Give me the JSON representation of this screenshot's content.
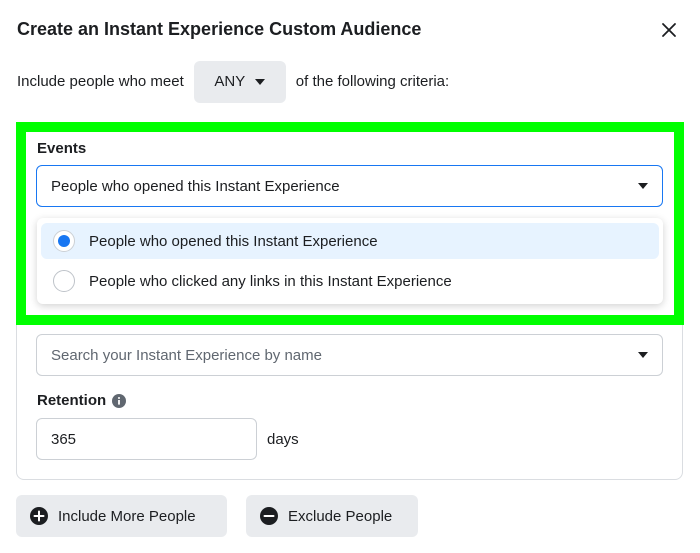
{
  "dialog": {
    "title": "Create an Instant Experience Custom Audience",
    "close_icon": "close-icon"
  },
  "criteria": {
    "prefix": "Include people who meet",
    "match_value": "ANY",
    "suffix": "of the following criteria:"
  },
  "events": {
    "label": "Events",
    "selected_value": "People who opened this Instant Experience",
    "options": [
      {
        "label": "People who opened this Instant Experience",
        "selected": true
      },
      {
        "label": "People who clicked any links in this Instant Experience",
        "selected": false
      }
    ]
  },
  "instant_experience": {
    "placeholder": "Search your Instant Experience by name"
  },
  "retention": {
    "label": "Retention",
    "value": "365",
    "unit": "days"
  },
  "actions": {
    "include_label": "Include More People",
    "exclude_label": "Exclude People"
  },
  "colors": {
    "accent": "#1877f2",
    "highlight": "#00ff00",
    "button_bg": "#e9ebee"
  }
}
